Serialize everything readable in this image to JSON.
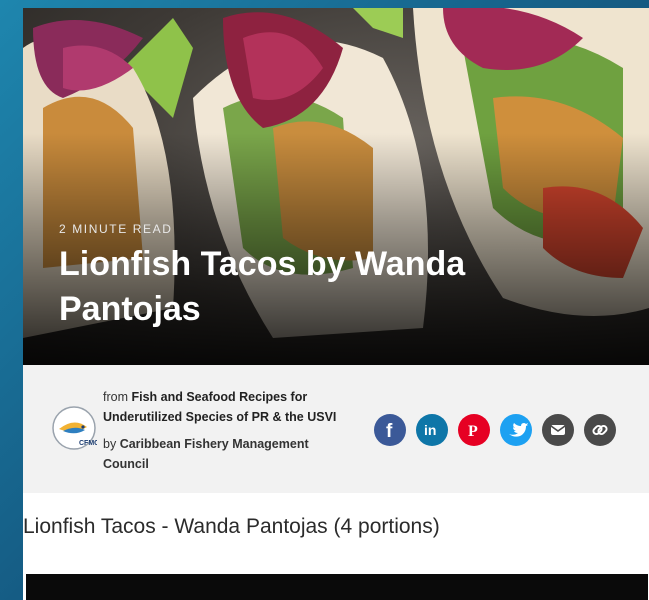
{
  "article": {
    "read_time": "2 MINUTE READ",
    "title": "Lionfish Tacos by Wanda Pantojas"
  },
  "source": {
    "from_prefix": "from",
    "collection_line1": "Fish and Seafood Recipes for",
    "collection_line2": "Underutilized Species of PR & the USVI",
    "by_prefix": "by",
    "author_line1": "Caribbean Fishery Management",
    "author_line2": "Council",
    "logo_text": "CFMC"
  },
  "share": {
    "items": [
      {
        "icon": "facebook-icon",
        "color": "#3b5998",
        "glyph": "f"
      },
      {
        "icon": "linkedin-icon",
        "color": "#0e76a8",
        "glyph": "in"
      },
      {
        "icon": "pinterest-icon",
        "color": "#e60023",
        "glyph": "P"
      },
      {
        "icon": "twitter-icon",
        "color": "#1da1f2",
        "glyph": ""
      },
      {
        "icon": "email-icon",
        "color": "#4a4a4a",
        "glyph": ""
      },
      {
        "icon": "link-icon",
        "color": "#4a4a4a",
        "glyph": ""
      }
    ]
  },
  "content": {
    "recipe_heading": "Lionfish Tacos - Wanda Pantojas (4 portions)"
  },
  "colors": {
    "background": "#1e86ae",
    "info_bar": "#f2f2f2"
  }
}
